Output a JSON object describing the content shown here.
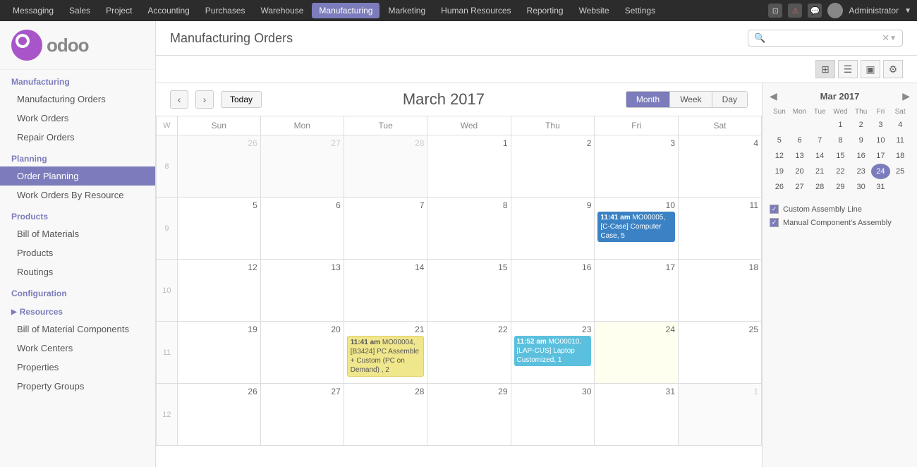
{
  "topnav": {
    "items": [
      {
        "label": "Messaging",
        "active": false
      },
      {
        "label": "Sales",
        "active": false
      },
      {
        "label": "Project",
        "active": false
      },
      {
        "label": "Accounting",
        "active": false
      },
      {
        "label": "Purchases",
        "active": false
      },
      {
        "label": "Warehouse",
        "active": false
      },
      {
        "label": "Manufacturing",
        "active": true
      },
      {
        "label": "Marketing",
        "active": false
      },
      {
        "label": "Human Resources",
        "active": false
      },
      {
        "label": "Reporting",
        "active": false
      },
      {
        "label": "Website",
        "active": false
      },
      {
        "label": "Settings",
        "active": false
      }
    ],
    "admin_label": "Administrator"
  },
  "sidebar": {
    "manufacturing_section": "Manufacturing",
    "manufacturing_orders": "Manufacturing Orders",
    "work_orders": "Work Orders",
    "repair_orders": "Repair Orders",
    "planning_section": "Planning",
    "order_planning": "Order Planning",
    "work_orders_by_resource": "Work Orders By Resource",
    "products_section": "Products",
    "bill_of_materials": "Bill of Materials",
    "products": "Products",
    "routings": "Routings",
    "configuration_section": "Configuration",
    "resources": "Resources",
    "bill_of_material_components": "Bill of Material Components",
    "work_centers": "Work Centers",
    "properties": "Properties",
    "property_groups": "Property Groups"
  },
  "header": {
    "title": "Manufacturing Orders",
    "search_placeholder": ""
  },
  "calendar": {
    "title": "March 2017",
    "month": "March",
    "year": "2017",
    "today_btn": "Today",
    "month_tab": "Month",
    "week_tab": "Week",
    "day_tab": "Day",
    "day_headers": [
      "W",
      "Sun",
      "Mon",
      "Tue",
      "Wed",
      "Thu",
      "Fri",
      "Sat"
    ],
    "rows": [
      {
        "week": "8",
        "days": [
          {
            "num": "26",
            "month": "other",
            "events": []
          },
          {
            "num": "27",
            "month": "other",
            "events": []
          },
          {
            "num": "28",
            "month": "other",
            "events": []
          },
          {
            "num": "1",
            "month": "current",
            "events": []
          },
          {
            "num": "2",
            "month": "current",
            "events": []
          },
          {
            "num": "3",
            "month": "current",
            "events": []
          },
          {
            "num": "4",
            "month": "current",
            "events": []
          }
        ]
      },
      {
        "week": "9",
        "days": [
          {
            "num": "5",
            "month": "current",
            "events": []
          },
          {
            "num": "6",
            "month": "current",
            "events": []
          },
          {
            "num": "7",
            "month": "current",
            "events": []
          },
          {
            "num": "8",
            "month": "current",
            "events": []
          },
          {
            "num": "9",
            "month": "current",
            "events": []
          },
          {
            "num": "10",
            "month": "current",
            "events": [
              {
                "type": "blue",
                "time": "11:41 am",
                "text": "MO00005, [C-Case] Computer Case, 5"
              }
            ]
          },
          {
            "num": "11",
            "month": "current",
            "events": []
          }
        ]
      },
      {
        "week": "10",
        "days": [
          {
            "num": "12",
            "month": "current",
            "events": []
          },
          {
            "num": "13",
            "month": "current",
            "events": []
          },
          {
            "num": "14",
            "month": "current",
            "events": []
          },
          {
            "num": "15",
            "month": "current",
            "events": []
          },
          {
            "num": "16",
            "month": "current",
            "events": []
          },
          {
            "num": "17",
            "month": "current",
            "events": []
          },
          {
            "num": "18",
            "month": "current",
            "events": []
          }
        ]
      },
      {
        "week": "11",
        "days": [
          {
            "num": "19",
            "month": "current",
            "events": []
          },
          {
            "num": "20",
            "month": "current",
            "events": []
          },
          {
            "num": "21",
            "month": "current",
            "events": [
              {
                "type": "yellow",
                "time": "11:41 am",
                "text": "MO00004, [B3424] PC Assemble + Custom (PC on Demand) , 2"
              }
            ]
          },
          {
            "num": "22",
            "month": "current",
            "events": []
          },
          {
            "num": "23",
            "month": "current",
            "events": [
              {
                "type": "teal",
                "time": "11:52 am",
                "text": "MO00010, [LAP-CUS] Laptop Customized, 1"
              }
            ]
          },
          {
            "num": "24",
            "month": "current",
            "today": true,
            "events": []
          },
          {
            "num": "25",
            "month": "current",
            "events": []
          }
        ]
      },
      {
        "week": "12",
        "days": [
          {
            "num": "26",
            "month": "current",
            "events": []
          },
          {
            "num": "27",
            "month": "current",
            "events": []
          },
          {
            "num": "28",
            "month": "current",
            "events": []
          },
          {
            "num": "29",
            "month": "current",
            "events": []
          },
          {
            "num": "30",
            "month": "current",
            "events": []
          },
          {
            "num": "31",
            "month": "current",
            "events": []
          },
          {
            "num": "1",
            "month": "other",
            "events": []
          }
        ]
      }
    ]
  },
  "mini_calendar": {
    "title": "Mar 2017",
    "day_headers": [
      "Sun",
      "Mon",
      "Tue",
      "Wed",
      "Thu",
      "Fri",
      "Sat"
    ],
    "rows": [
      [
        "",
        "",
        "",
        "1",
        "2",
        "3",
        "4"
      ],
      [
        "5",
        "6",
        "7",
        "8",
        "9",
        "10",
        "11"
      ],
      [
        "12",
        "13",
        "14",
        "15",
        "16",
        "17",
        "18"
      ],
      [
        "19",
        "20",
        "21",
        "22",
        "23",
        "24",
        "25"
      ],
      [
        "26",
        "27",
        "28",
        "29",
        "30",
        "31",
        ""
      ]
    ],
    "today_day": "24"
  },
  "legend": {
    "items": [
      {
        "label": "Custom Assembly Line"
      },
      {
        "label": "Manual Component's Assembly"
      }
    ]
  }
}
